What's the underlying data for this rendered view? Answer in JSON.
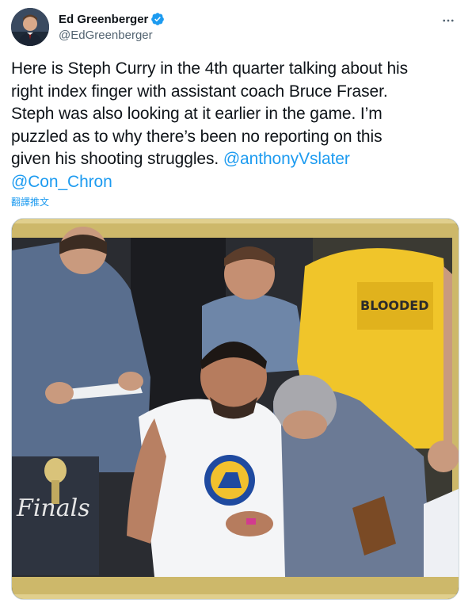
{
  "author": {
    "display_name": "Ed Greenberger",
    "handle": "@EdGreenberger",
    "verified": true,
    "avatar_icon": "profile-photo"
  },
  "tweet": {
    "text_lines": [
      "Here is Steph Curry in the 4th quarter talking about his",
      "right index finger with assistant coach Bruce Fraser.",
      "Steph was also looking at it earlier in the game. I’m",
      "puzzled as to why there’s been no reporting on this",
      "given his shooting struggles. "
    ],
    "mention_1": "@anthonyVslater",
    "mention_2": "@Con_Chron",
    "translate_label": "翻譯推文"
  },
  "media": {
    "type": "photo",
    "finals_logo_text": "Finals",
    "shirt_text": "BLOODED"
  },
  "colors": {
    "link": "#1d9bf0",
    "text": "#0f1419",
    "secondary": "#536471",
    "gold_frame": "#cdb86a"
  },
  "icons": {
    "verified": "verified-badge-icon",
    "more": "more-options-icon"
  }
}
